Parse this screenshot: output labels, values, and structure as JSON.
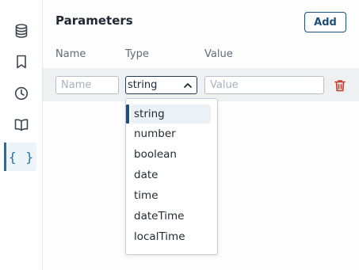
{
  "sidebar": {
    "items": [
      {
        "icon": "database-icon",
        "name": "sidebar-item-database"
      },
      {
        "icon": "bookmark-icon",
        "name": "sidebar-item-saved"
      },
      {
        "icon": "clock-icon",
        "name": "sidebar-item-history"
      },
      {
        "icon": "book-icon",
        "name": "sidebar-item-docs"
      },
      {
        "icon": "braces-icon",
        "name": "sidebar-item-parameters",
        "label": "{ }",
        "active": true
      }
    ]
  },
  "panel": {
    "title": "Parameters",
    "add_label": "Add",
    "columns": {
      "name": "Name",
      "type": "Type",
      "value": "Value"
    }
  },
  "row": {
    "name_placeholder": "Name",
    "type_value": "string",
    "value_placeholder": "Value"
  },
  "dropdown": {
    "options": [
      "string",
      "number",
      "boolean",
      "date",
      "time",
      "dateTime",
      "localTime"
    ],
    "selected": "string"
  },
  "colors": {
    "accent": "#1e4f7a",
    "active_icon": "#1e6fa8",
    "delete": "#c0392b",
    "row_background": "#eef0f2"
  }
}
